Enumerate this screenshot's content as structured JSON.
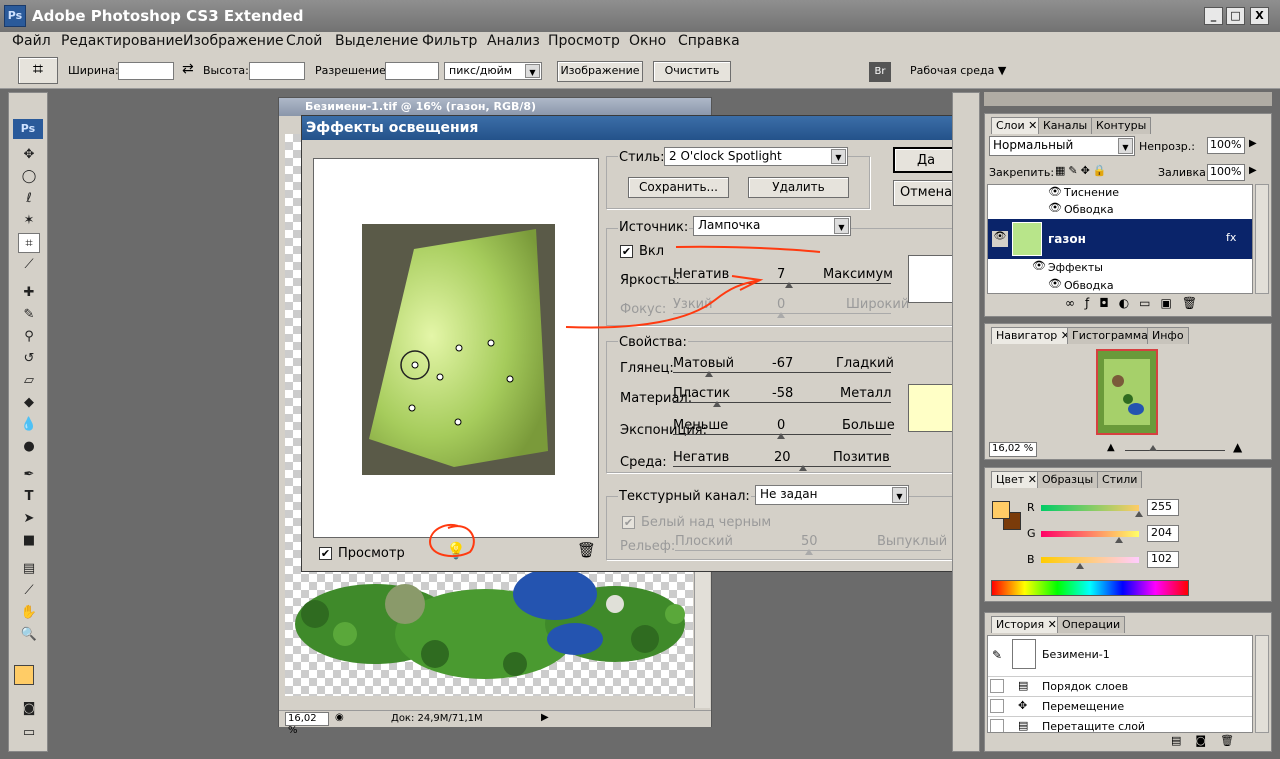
{
  "app": {
    "title": "Adobe Photoshop CS3 Extended",
    "ps_badge": "Ps",
    "minimize": "_",
    "maximize": "□",
    "close": "X"
  },
  "menu": [
    "Файл",
    "Редактирование",
    "Изображение",
    "Слой",
    "Выделение",
    "Фильтр",
    "Анализ",
    "Просмотр",
    "Окно",
    "Справка"
  ],
  "options": {
    "width_label": "Ширина:",
    "height_label": "Высота:",
    "resolution_label": "Разрешение:",
    "units": "пикс/дюйм",
    "image_btn": "Изображение",
    "clear_btn": "Очистить",
    "workspace": "Рабочая среда"
  },
  "toolbox": {
    "badge": "Ps"
  },
  "document": {
    "title": "Безимени-1.tif @ 16% (газон, RGB/8)",
    "zoom": "16,02 %",
    "doc_info": "Док: 24,9M/71,1M"
  },
  "dialog": {
    "title": "Эффекты освещения",
    "style_label": "Стиль:",
    "style_value": "2 O'clock Spotlight",
    "save_btn": "Сохранить...",
    "delete_btn": "Удалить",
    "ok_btn": "Да",
    "cancel_btn": "Отмена",
    "source_label": "Источник:",
    "source_value": "Лампочка",
    "on_label": "Вкл",
    "brightness": {
      "label": "Яркость:",
      "min": "Негатив",
      "max": "Максимум",
      "value": "7"
    },
    "focus": {
      "label": "Фокус:",
      "min": "Узкий",
      "max": "Широкий",
      "value": "0"
    },
    "properties_label": "Свойства:",
    "gloss": {
      "label": "Глянец:",
      "min": "Матовый",
      "max": "Гладкий",
      "value": "-67"
    },
    "material": {
      "label": "Материал:",
      "min": "Пластик",
      "max": "Металл",
      "value": "-58"
    },
    "exposure": {
      "label": "Экспониция:",
      "min": "Меньше",
      "max": "Больше",
      "value": "0"
    },
    "ambience": {
      "label": "Среда:",
      "min": "Негатив",
      "max": "Позитив",
      "value": "20"
    },
    "texture_label": "Текстурный канал:",
    "texture_value": "Не задан",
    "white_high_label": "Белый над черным",
    "relief": {
      "label": "Рельеф:",
      "min": "Плоский",
      "max": "Выпуклый",
      "value": "50"
    },
    "preview_label": "Просмотр"
  },
  "layers_panel": {
    "tabs": [
      "Слои",
      "Каналы",
      "Контуры"
    ],
    "blend_mode": "Нормальный",
    "opacity_label": "Непрозр.:",
    "opacity_value": "100%",
    "lock_label": "Закрепить:",
    "fill_label": "Заливка:",
    "fill_value": "100%",
    "rows": {
      "emboss": "Тиснение",
      "stroke1": "Обводка",
      "layer_name": "газон",
      "effects": "Эффекты",
      "stroke2": "Обводка"
    }
  },
  "navigator_panel": {
    "tabs": [
      "Навигатор",
      "Гистограмма",
      "Инфо"
    ],
    "zoom": "16,02 %"
  },
  "color_panel": {
    "tabs": [
      "Цвет",
      "Образцы",
      "Стили"
    ],
    "r_label": "R",
    "g_label": "G",
    "b_label": "B",
    "r_value": "255",
    "g_value": "204",
    "b_value": "102",
    "foreground": "#ffcc66",
    "background": "#7a3b0a"
  },
  "history_panel": {
    "tabs": [
      "История",
      "Операции"
    ],
    "snapshot": "Безимени-1",
    "items": [
      "Порядок слоев",
      "Перемещение",
      "Перетащите слой"
    ]
  }
}
